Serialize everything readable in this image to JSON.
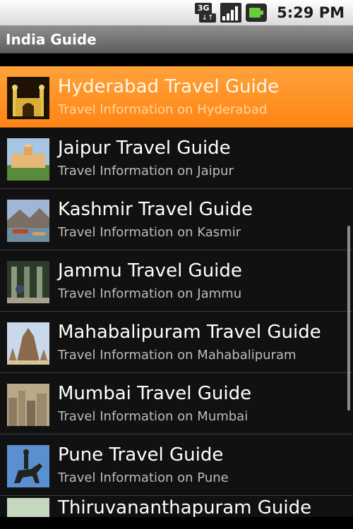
{
  "status_bar": {
    "network_top": "3G",
    "network_bottom": "↓↑",
    "signal_icon": "signal-bars-icon",
    "battery_icon": "battery-icon",
    "time": "5:29 PM"
  },
  "app": {
    "title": "India Guide"
  },
  "list": {
    "items": [
      {
        "title": "Hyderabad Travel Guide",
        "subtitle": "Travel Information on Hyderabad",
        "thumb": "hyderabad-charminar-icon",
        "selected": true
      },
      {
        "title": "Jaipur Travel Guide",
        "subtitle": "Travel Information on Jaipur",
        "thumb": "jaipur-palace-icon"
      },
      {
        "title": "Kashmir Travel Guide",
        "subtitle": "Travel Information on Kasmir",
        "thumb": "kashmir-lake-icon"
      },
      {
        "title": "Jammu Travel Guide",
        "subtitle": "Travel Information on Jammu",
        "thumb": "jammu-temple-icon"
      },
      {
        "title": "Mahabalipuram Travel Guide",
        "subtitle": "Travel Information on Mahabalipuram",
        "thumb": "mahabalipuram-temple-icon"
      },
      {
        "title": "Mumbai Travel Guide",
        "subtitle": "Travel Information on Mumbai",
        "thumb": "mumbai-skyline-icon"
      },
      {
        "title": "Pune Travel Guide",
        "subtitle": "Travel Information on Pune",
        "thumb": "pune-statue-icon"
      },
      {
        "title": "Thiruvananthapuram Guide",
        "subtitle": "",
        "thumb": "thiruvananthapuram-icon"
      }
    ]
  },
  "colors": {
    "selected_start": "#ffa23a",
    "selected_end": "#ff8514",
    "row_bg": "#111111",
    "divider": "#3d3d3d"
  }
}
